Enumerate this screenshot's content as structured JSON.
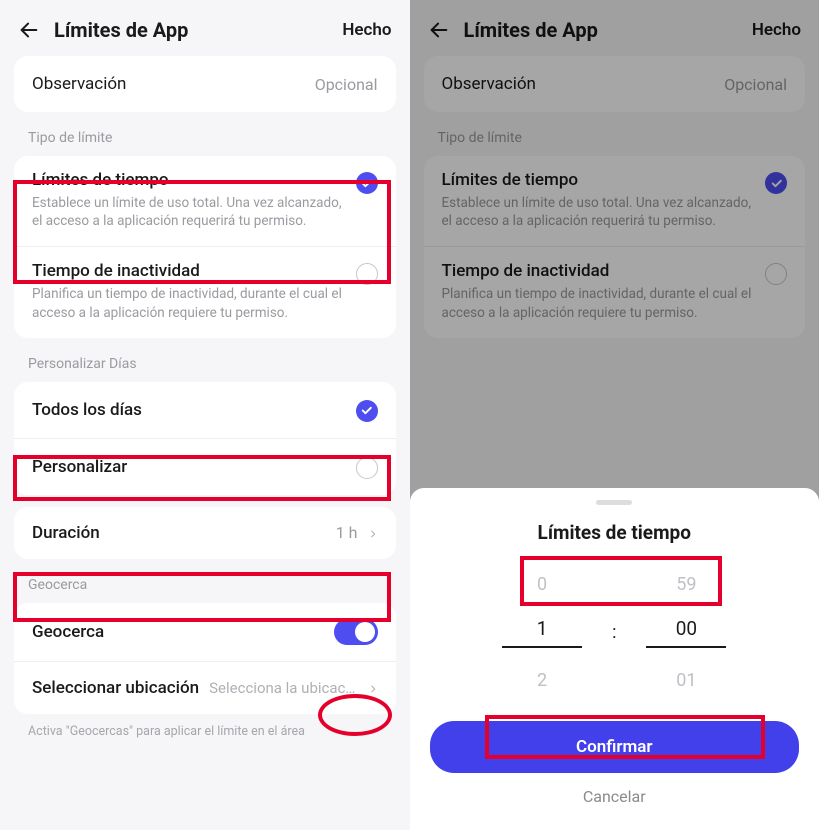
{
  "left": {
    "header": {
      "title": "Límites de App",
      "done": "Hecho"
    },
    "observation": {
      "label": "Observación",
      "placeholder": "Opcional"
    },
    "limit_type_label": "Tipo de límite",
    "limits": [
      {
        "title": "Límites de tiempo",
        "desc": "Establece un límite de uso total. Una vez alcanzado, el acceso a la aplicación requerirá tu permiso.",
        "selected": true
      },
      {
        "title": "Tiempo de inactividad",
        "desc": "Planifica un tiempo de inactividad, durante el cual el acceso a la aplicación requiere tu permiso.",
        "selected": false
      }
    ],
    "customize_label": "Personalizar Días",
    "days": [
      {
        "title": "Todos los días",
        "selected": true
      },
      {
        "title": "Personalizar",
        "selected": false
      }
    ],
    "duration": {
      "title": "Duración",
      "value": "1 h"
    },
    "geofence_label": "Geocerca",
    "geofence_toggle": {
      "title": "Geocerca",
      "on": true
    },
    "location": {
      "title": "Seleccionar ubicación",
      "placeholder": "Selecciona la ubicaci…"
    },
    "footnote": "Activa \"Geocercas\" para aplicar el límite en el área"
  },
  "right": {
    "header": {
      "title": "Límites de App",
      "done": "Hecho"
    },
    "observation": {
      "label": "Observación",
      "placeholder": "Opcional"
    },
    "limit_type_label": "Tipo de límite",
    "limits": [
      {
        "title": "Límites de tiempo",
        "desc": "Establece un límite de uso total. Una vez alcanzado, el acceso a la aplicación requerirá tu permiso.",
        "selected": true
      },
      {
        "title": "Tiempo de inactividad",
        "desc": "Planifica un tiempo de inactividad, durante el cual el acceso a la aplicación requiere tu permiso.",
        "selected": false
      }
    ],
    "sheet": {
      "title": "Límites de tiempo",
      "hours": {
        "prev": "0",
        "current": "1",
        "next": "2"
      },
      "minutes": {
        "prev": "59",
        "current": "00",
        "next": "01"
      },
      "confirm": "Confirmar",
      "cancel": "Cancelar"
    }
  },
  "colors": {
    "accent": "#4e4ef0",
    "highlight": "#e4002b"
  }
}
